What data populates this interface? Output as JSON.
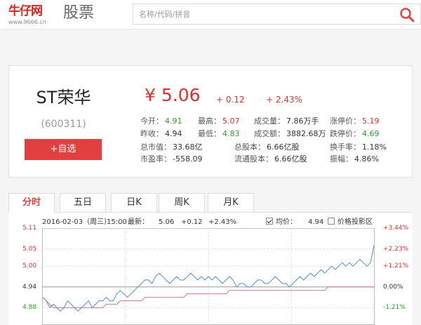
{
  "header": {
    "logo_text": "牛仔网",
    "logo_url": "www.9666.cn",
    "section": "股票",
    "search_placeholder": "名称/代码/拼音"
  },
  "quote": {
    "name": "ST荣华",
    "code": "(600311)",
    "add_label": "+自选",
    "price": "¥ 5.06",
    "change": "+ 0.12",
    "change_pct": "+ 2.43%",
    "stats": {
      "open_label": "今开：",
      "open": "4.91",
      "high_label": "最高：",
      "high": "5.07",
      "volume_label": "成交量：",
      "volume": "7.86万手",
      "limit_up_label": "涨停价：",
      "limit_up": "5.19",
      "prev_label": "昨收：",
      "prev": "4.94",
      "low_label": "最低：",
      "low": "4.83",
      "amount_label": "成交额：",
      "amount": "3882.68万",
      "limit_down_label": "跌停价：",
      "limit_down": "4.69",
      "mktcap_label": "总市值：",
      "mktcap": "33.68亿",
      "shares_label": "总股本：",
      "shares": "6.66亿股",
      "turnover_label": "换手率：",
      "turnover": "1.18%",
      "pe_label": "市盈率：",
      "pe": "-558.09",
      "float_label": "流通股本：",
      "float": "6.66亿股",
      "amplitude_label": "振幅：",
      "amplitude": "4.86%"
    }
  },
  "tabs": [
    "分时",
    "五日",
    "日K",
    "周K",
    "月K"
  ],
  "chart_info": {
    "date": "2016-02-03",
    "weekday": "（周三）",
    "time": "15:00",
    "latest_label": "最新：",
    "latest": "5.06",
    "change": "+0.12",
    "change_pct": "+2.43%",
    "avg_label": "均价：",
    "avg": "4.94",
    "projection_label": "价格投影区"
  },
  "chart_data": {
    "type": "line",
    "ylabels_left": [
      "5.11",
      "5.05",
      "5.00",
      "4.94",
      "4.88"
    ],
    "ylabels_right": [
      "+3.44%",
      "+2.23%",
      "+1.21%",
      "0.00%",
      "-1.21%"
    ],
    "ylim": [
      4.83,
      5.11
    ],
    "prev_close": 4.94,
    "colors": {
      "price": "#4a90d9",
      "avg": "#c97a86",
      "grid": "#e2e2e2",
      "up": "#e62b2b",
      "down": "#2f9a2f"
    },
    "series": [
      {
        "name": "价格",
        "values": [
          4.91,
          4.9,
          4.88,
          4.89,
          4.88,
          4.87,
          4.88,
          4.9,
          4.89,
          4.88,
          4.87,
          4.88,
          4.89,
          4.9,
          4.88,
          4.89,
          4.9,
          4.9,
          4.91,
          4.9,
          4.9,
          4.92,
          4.93,
          4.92,
          4.91,
          4.92,
          4.93,
          4.94,
          4.95,
          4.96,
          4.96,
          4.95,
          4.97,
          4.98,
          4.97,
          4.96,
          4.95,
          4.96,
          4.97,
          4.96,
          4.96,
          4.97,
          4.98,
          4.97,
          4.96,
          4.97,
          4.96,
          4.97,
          4.96,
          4.97,
          4.96,
          4.95,
          4.96,
          4.97,
          4.96,
          4.94,
          4.95,
          4.95,
          4.94,
          4.94,
          4.95,
          4.96,
          4.96,
          4.95,
          4.95,
          4.96,
          4.97,
          4.96,
          4.95,
          4.95,
          4.94,
          4.95,
          4.96,
          4.97,
          4.96,
          4.97,
          4.98,
          4.97,
          4.98,
          4.99,
          4.98,
          4.99,
          5.0,
          4.99,
          5.0,
          5.01,
          5.0,
          5.01,
          5.0,
          5.01,
          5.02,
          5.01,
          5.0,
          5.01,
          5.06
        ]
      },
      {
        "name": "均价",
        "values": [
          4.91,
          4.9,
          4.89,
          4.88,
          4.88,
          4.88,
          4.88,
          4.88,
          4.88,
          4.88,
          4.88,
          4.88,
          4.88,
          4.88,
          4.88,
          4.88,
          4.88,
          4.88,
          4.89,
          4.89,
          4.89,
          4.89,
          4.9,
          4.9,
          4.9,
          4.9,
          4.9,
          4.9,
          4.9,
          4.91,
          4.91,
          4.91,
          4.91,
          4.91,
          4.91,
          4.91,
          4.91,
          4.91,
          4.91,
          4.91,
          4.91,
          4.92,
          4.92,
          4.92,
          4.92,
          4.92,
          4.92,
          4.92,
          4.92,
          4.92,
          4.92,
          4.92,
          4.92,
          4.93,
          4.93,
          4.93,
          4.93,
          4.93,
          4.93,
          4.93,
          4.93,
          4.93,
          4.93,
          4.93,
          4.93,
          4.93,
          4.93,
          4.93,
          4.93,
          4.93,
          4.93,
          4.93,
          4.93,
          4.93,
          4.93,
          4.93,
          4.93,
          4.93,
          4.93,
          4.93,
          4.93,
          4.94,
          4.94,
          4.94,
          4.94,
          4.94,
          4.94,
          4.94,
          4.94,
          4.94,
          4.94,
          4.94,
          4.94,
          4.94,
          4.94
        ]
      }
    ]
  }
}
